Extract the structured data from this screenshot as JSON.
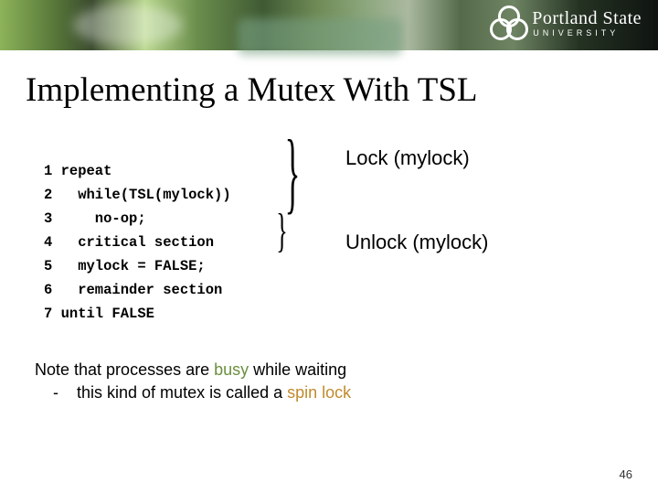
{
  "logo": {
    "name": "Portland State",
    "sub": "UNIVERSITY"
  },
  "title": "Implementing a Mutex With TSL",
  "code": {
    "l1": "1 repeat",
    "l2": "2   while(TSL(mylock))",
    "l3": "3     no-op;",
    "l4": "4   critical section",
    "l5": "5   mylock = FALSE;",
    "l6": "6   remainder section",
    "l7": "7 until FALSE"
  },
  "annot": {
    "lock": "Lock (mylock)",
    "unlock": "Unlock (mylock)"
  },
  "note": {
    "part1": "Note that processes are ",
    "busy": "busy",
    "part2": " while waiting",
    "line2a": "this kind of mutex is called a ",
    "spin": "spin lock"
  },
  "page": "46"
}
